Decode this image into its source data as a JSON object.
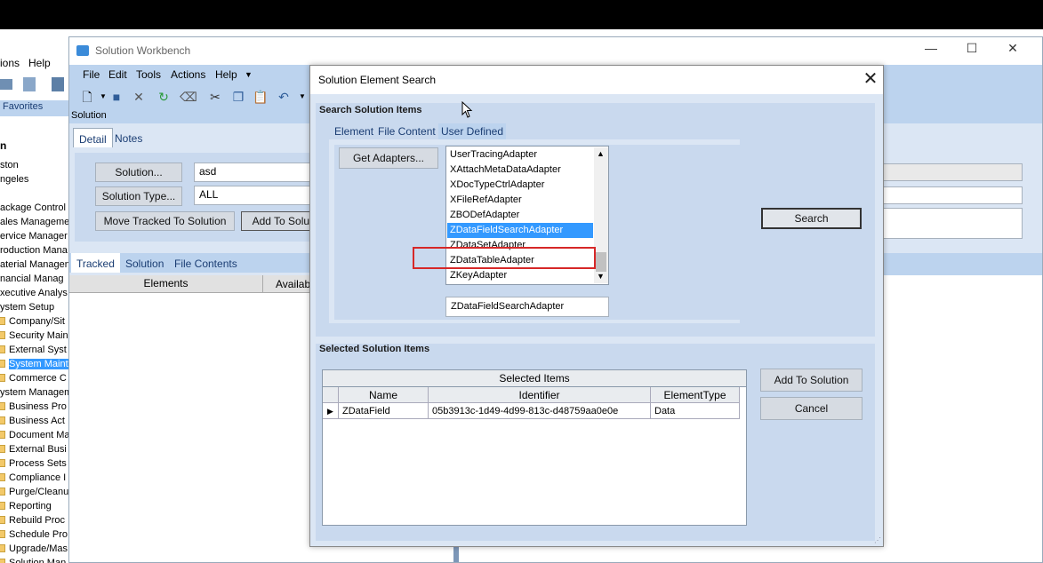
{
  "background_app": {
    "menu": [
      "ions",
      "Help"
    ],
    "favorites": "Favorites",
    "tree_header": "n",
    "tree": [
      {
        "label": "ston",
        "folder": false
      },
      {
        "label": "ngeles",
        "folder": false
      },
      {
        "label": "",
        "folder": false
      },
      {
        "label": "ackage Control",
        "folder": false
      },
      {
        "label": "ales Manageme",
        "folder": false
      },
      {
        "label": "ervice Manager",
        "folder": false
      },
      {
        "label": "roduction Mana",
        "folder": false
      },
      {
        "label": "aterial Managen",
        "folder": false
      },
      {
        "label": "nancial Manag",
        "folder": false
      },
      {
        "label": "xecutive Analys",
        "folder": false
      },
      {
        "label": "ystem Setup",
        "folder": false
      },
      {
        "label": "Company/Sit",
        "folder": true
      },
      {
        "label": "Security Main",
        "folder": true
      },
      {
        "label": "External Syst",
        "folder": true
      },
      {
        "label": "System Maint",
        "folder": true,
        "selected": true
      },
      {
        "label": "Commerce C",
        "folder": true
      },
      {
        "label": "ystem Managem",
        "folder": false
      },
      {
        "label": "Business Pro",
        "folder": true
      },
      {
        "label": "Business Act",
        "folder": true
      },
      {
        "label": "Document Ma",
        "folder": true
      },
      {
        "label": "External Busi",
        "folder": true
      },
      {
        "label": "Process Sets",
        "folder": true
      },
      {
        "label": "Compliance I",
        "folder": true
      },
      {
        "label": "Purge/Cleanu",
        "folder": true
      },
      {
        "label": "Reporting",
        "folder": true
      },
      {
        "label": "Rebuild Proc",
        "folder": true
      },
      {
        "label": "Schedule Pro",
        "folder": true
      },
      {
        "label": "Upgrade/Mas",
        "folder": true
      },
      {
        "label": "Solution Man",
        "folder": true
      }
    ]
  },
  "workbench": {
    "title": "Solution Workbench",
    "menu": [
      "File",
      "Edit",
      "Tools",
      "Actions",
      "Help"
    ],
    "solution_label": "Solution",
    "detail_tabs": [
      "Detail",
      "Notes"
    ],
    "solution_button": "Solution...",
    "solution_value": "asd",
    "solution_type_button": "Solution Type...",
    "solution_type_value": "ALL",
    "move_tracked_button": "Move Tracked To Solution",
    "add_to_solution_button": "Add To Solut",
    "tracked_tabs": [
      "Tracked",
      "Solution",
      "File Contents"
    ],
    "columns": [
      "Elements",
      "Availab"
    ]
  },
  "dialog": {
    "title": "Solution Element Search",
    "search_group_title": "Search Solution Items",
    "tabs": [
      "Element",
      "File Content",
      "User Defined"
    ],
    "active_tab": "User Defined",
    "get_adapters_button": "Get Adapters...",
    "search_button": "Search",
    "adapters": [
      "UserTracingAdapter",
      "XAttachMetaDataAdapter",
      "XDocTypeCtrlAdapter",
      "XFileRefAdapter",
      "ZBODefAdapter",
      "ZDataFieldSearchAdapter",
      "ZDataSetAdapter",
      "ZDataTableAdapter",
      "ZKeyAdapter"
    ],
    "selected_adapter": "ZDataFieldSearchAdapter",
    "adapter_field_value": "ZDataFieldSearchAdapter",
    "selected_group_title": "Selected Solution Items",
    "grid_title": "Selected Items",
    "grid_columns": [
      "Name",
      "Identifier",
      "ElementType"
    ],
    "grid_rows": [
      {
        "name": "ZDataField",
        "identifier": "05b3913c-1d49-4d99-813c-d48759aa0e0e",
        "type": "Data"
      }
    ],
    "add_to_solution_button": "Add To Solution",
    "cancel_button": "Cancel"
  },
  "colors": {
    "panel_blue": "#bcd3ee",
    "light_blue": "#dbe6f4",
    "selection": "#3399ff",
    "highlight_red": "#d62828"
  }
}
